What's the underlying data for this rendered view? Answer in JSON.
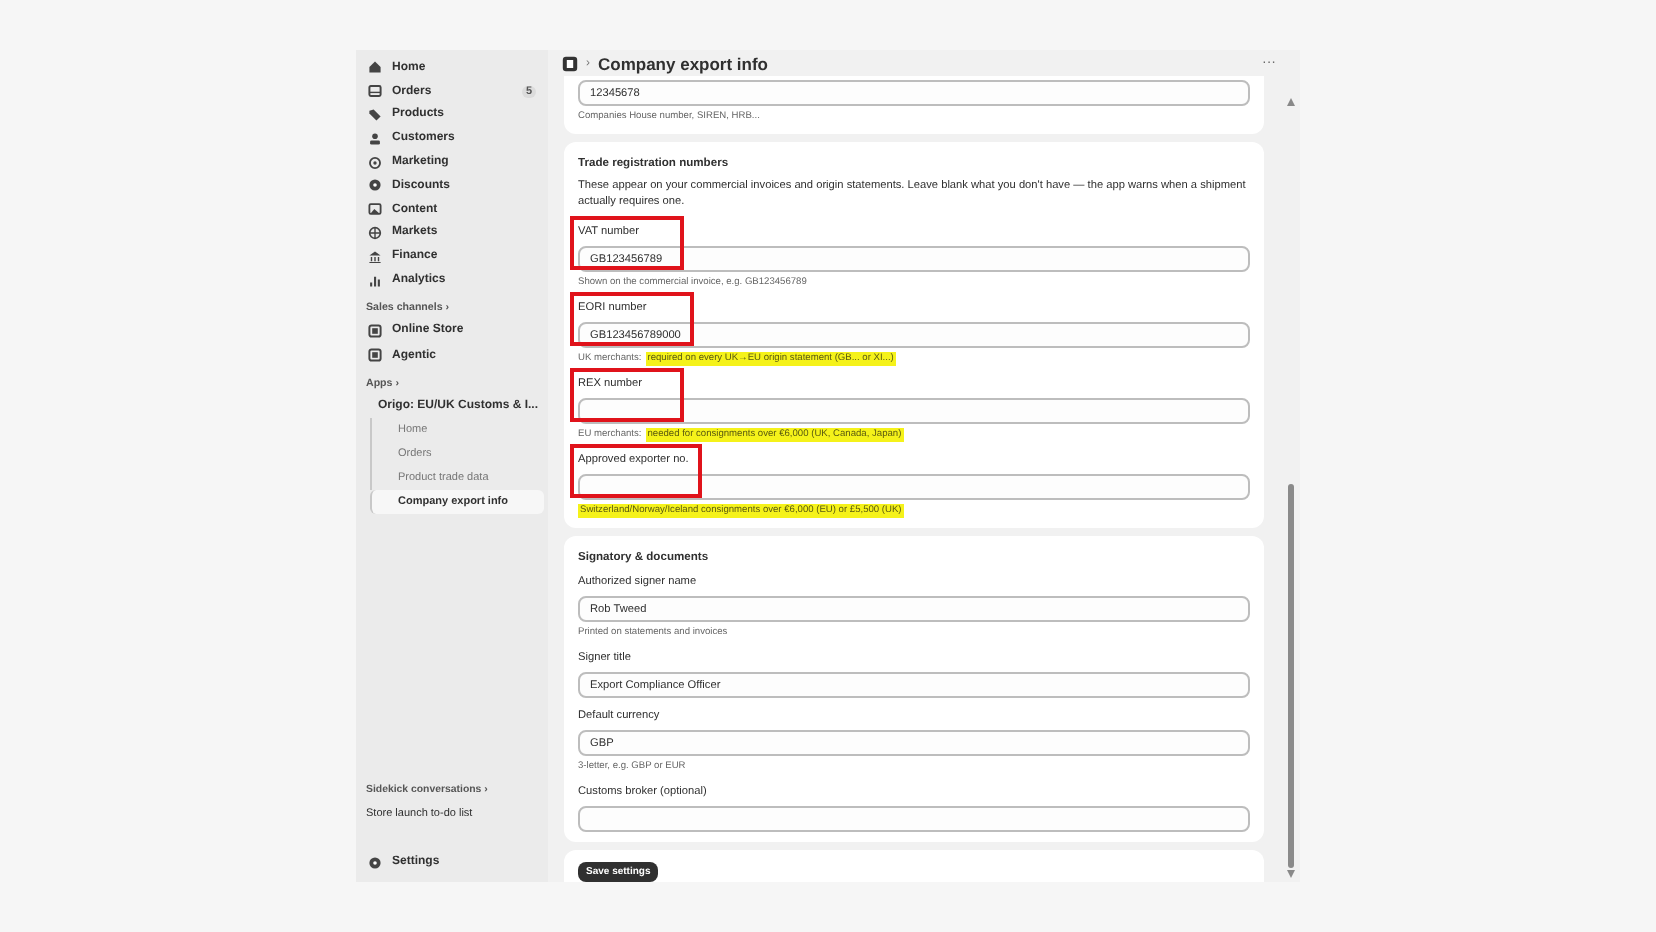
{
  "sidebar": {
    "items": [
      {
        "label": "Home",
        "selected": false
      },
      {
        "label": "Orders",
        "badge": "5",
        "selected": false
      },
      {
        "label": "Products",
        "selected": false
      },
      {
        "label": "Customers",
        "selected": false
      },
      {
        "label": "Marketing",
        "selected": false
      },
      {
        "label": "Discounts",
        "selected": false
      },
      {
        "label": "Content",
        "selected": false
      },
      {
        "label": "Markets",
        "selected": false
      },
      {
        "label": "Finance",
        "selected": false
      },
      {
        "label": "Analytics",
        "selected": false
      }
    ],
    "sales_channels": {
      "heading": "Sales channels ›",
      "items": [
        {
          "label": "Online Store"
        },
        {
          "label": "Agentic"
        }
      ]
    },
    "apps": {
      "heading": "Apps ›",
      "app": "Origo: EU/UK Customs & I...",
      "subitems": [
        {
          "label": "Home",
          "selected": false
        },
        {
          "label": "Orders",
          "selected": false
        },
        {
          "label": "Product trade data",
          "selected": false
        },
        {
          "label": "Company export info",
          "selected": true
        }
      ]
    },
    "footer": [
      {
        "label": "Sidekick conversations ›"
      },
      {
        "label": "Store launch to-do list"
      }
    ],
    "settings": "Settings"
  },
  "header": {
    "breadcrumb_separator": "›",
    "title": "Company export info",
    "menu": "···"
  },
  "cards": [
    {
      "fields": [
        {
          "value": "12345678",
          "hint": "Companies House number, SIREN, HRB..."
        }
      ]
    },
    {
      "title": "Trade registration numbers",
      "description": "These appear on your commercial invoices and origin statements. Leave blank what you don't have — the app warns when a shipment actually requires one.",
      "fields": [
        {
          "label": "VAT number",
          "value": "GB123456789",
          "hint": "Shown on the commercial invoice, e.g. GB123456789",
          "annotated": true
        },
        {
          "label": "EORI number",
          "value": "GB123456789000",
          "hint_prefix": "UK merchants:",
          "hint": "required on every UK→EU origin statement (GB... or XI...)",
          "hint_highlighted": true,
          "annotated": true
        },
        {
          "label": "REX number",
          "hint_prefix": "EU merchants:",
          "hint": "needed for consignments over €6,000 (UK, Canada, Japan)",
          "hint_highlighted": true,
          "annotated": true
        },
        {
          "label": "Approved exporter no.",
          "hint": "Switzerland/Norway/Iceland consignments over €6,000 (EU) or £5,500 (UK)",
          "hint_highlighted": true,
          "annotated": true
        }
      ]
    },
    {
      "title": "Signatory & documents",
      "fields": [
        {
          "label": "Authorized signer name",
          "value": "Rob Tweed",
          "hint": "Printed on statements and invoices"
        },
        {
          "label": "Signer title",
          "value": "Export Compliance Officer"
        },
        {
          "label": "Default currency",
          "value": "GBP",
          "hint": "3-letter, e.g. GBP or EUR"
        },
        {
          "label": "Customs broker (optional)"
        }
      ]
    }
  ],
  "save_button": "Save settings"
}
